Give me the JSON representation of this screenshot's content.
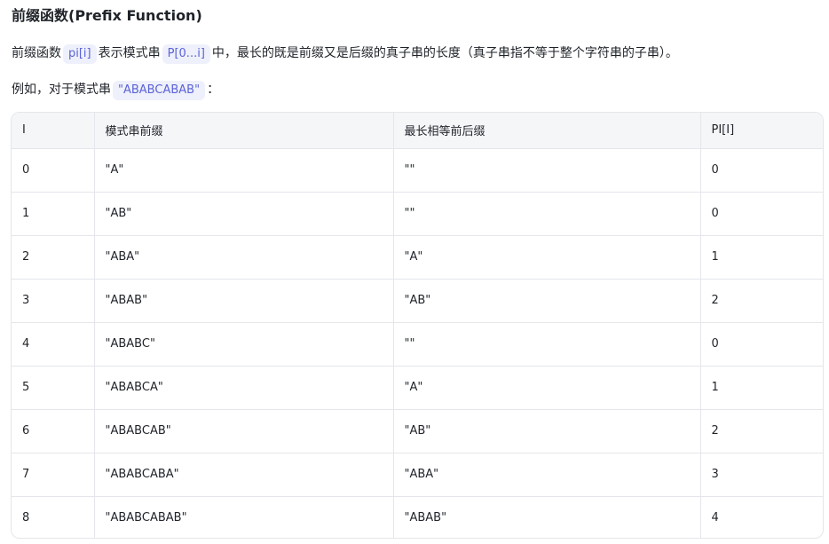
{
  "heading": "前缀函数(Prefix Function)",
  "para1": {
    "t1": "前缀函数",
    "c1": "pi[i]",
    "t2": "表示模式串",
    "c2": "P[0...i]",
    "t3": "中，最长的既是前缀又是后缀的真子串的长度（真子串指不等于整个字符串的子串）。"
  },
  "para2": {
    "t1": "例如，对于模式串",
    "c1": "\"ABABCABAB\"",
    "t2": "："
  },
  "table": {
    "headers": [
      "I",
      "模式串前缀",
      "最长相等前后缀",
      "PI[I]"
    ],
    "rows": [
      [
        "0",
        "\"A\"",
        "\"\"",
        "0"
      ],
      [
        "1",
        "\"AB\"",
        "\"\"",
        "0"
      ],
      [
        "2",
        "\"ABA\"",
        "\"A\"",
        "1"
      ],
      [
        "3",
        "\"ABAB\"",
        "\"AB\"",
        "2"
      ],
      [
        "4",
        "\"ABABC\"",
        "\"\"",
        "0"
      ],
      [
        "5",
        "\"ABABCA\"",
        "\"A\"",
        "1"
      ],
      [
        "6",
        "\"ABABCAB\"",
        "\"AB\"",
        "2"
      ],
      [
        "7",
        "\"ABABCABA\"",
        "\"ABA\"",
        "3"
      ],
      [
        "8",
        "\"ABABCABAB\"",
        "\"ABAB\"",
        "4"
      ]
    ]
  }
}
